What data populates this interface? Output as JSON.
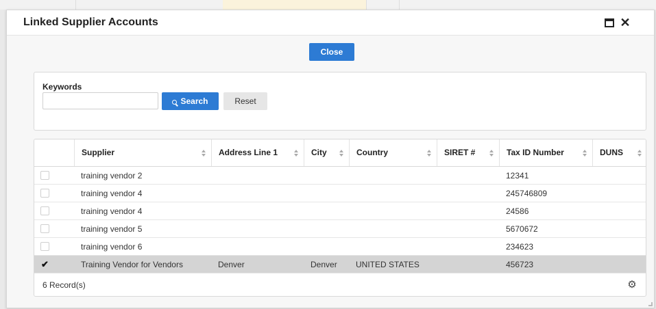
{
  "dialog": {
    "title": "Linked Supplier Accounts",
    "close_label": "Close",
    "maximize_icon": "maximize-icon",
    "close_icon": "close-icon"
  },
  "search": {
    "keywords_label": "Keywords",
    "keywords_value": "",
    "search_label": "Search",
    "reset_label": "Reset"
  },
  "grid": {
    "columns": [
      "Supplier",
      "Address Line 1",
      "City",
      "Country",
      "SIRET #",
      "Tax ID Number",
      "DUNS"
    ],
    "rows": [
      {
        "checked": false,
        "supplier": "training vendor 2",
        "address": "",
        "city": "",
        "country": "",
        "siret": "",
        "tax_id": "12341",
        "duns": ""
      },
      {
        "checked": false,
        "supplier": "training vendor 4",
        "address": "",
        "city": "",
        "country": "",
        "siret": "",
        "tax_id": "245746809",
        "duns": ""
      },
      {
        "checked": false,
        "supplier": "training vendor 4",
        "address": "",
        "city": "",
        "country": "",
        "siret": "",
        "tax_id": "24586",
        "duns": ""
      },
      {
        "checked": false,
        "supplier": "training vendor 5",
        "address": "",
        "city": "",
        "country": "",
        "siret": "",
        "tax_id": "5670672",
        "duns": ""
      },
      {
        "checked": false,
        "supplier": "training vendor 6",
        "address": "",
        "city": "",
        "country": "",
        "siret": "",
        "tax_id": "234623",
        "duns": ""
      },
      {
        "checked": true,
        "supplier": "Training Vendor for Vendors",
        "address": "Denver",
        "city": "Denver",
        "country": "UNITED STATES",
        "siret": "",
        "tax_id": "456723",
        "duns": ""
      }
    ],
    "record_count": "6 Record(s)",
    "settings_icon": "gear-icon"
  },
  "colors": {
    "primary": "#2d7bd4",
    "selected_row": "#d4d4d4"
  }
}
